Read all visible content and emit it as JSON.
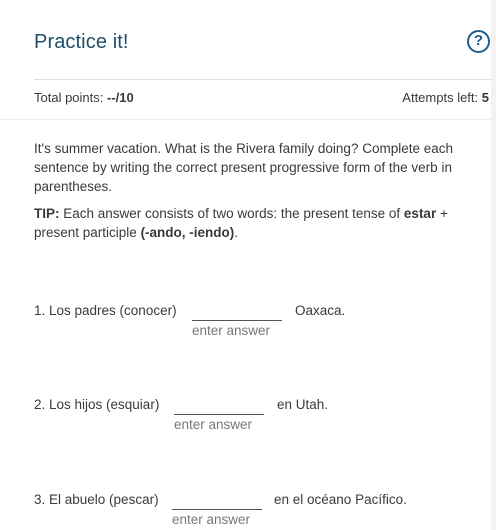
{
  "header": {
    "title": "Practice it!",
    "help_icon": "question-circle-icon",
    "total_points_label": "Total points: ",
    "total_points_value": "--/10",
    "attempts_label": "Attempts left: ",
    "attempts_value": "5"
  },
  "instructions": {
    "text": "It's summer vacation. What is the Rivera family doing? Complete each sentence by writing the correct present progressive form of the verb in parentheses.",
    "tip_label": "TIP:",
    "tip_text_1": " Each answer consists of two words: the present tense of ",
    "tip_bold_1": "estar",
    "tip_text_2": " + present participle ",
    "tip_bold_2": "(-ando, -iendo)",
    "tip_text_3": "."
  },
  "questions": [
    {
      "prompt": "1. Los padres (conocer)",
      "value": "",
      "placeholder": "enter answer",
      "suffix": "Oaxaca."
    },
    {
      "prompt": "2. Los hijos (esquiar)",
      "value": "",
      "placeholder": "enter answer",
      "suffix": "en Utah."
    },
    {
      "prompt": "3. El abuelo (pescar)",
      "value": "",
      "placeholder": "enter answer",
      "suffix": "en el océano Pacífico."
    }
  ],
  "colors": {
    "title": "#1f4e6b",
    "accent": "#1b5f8c"
  }
}
